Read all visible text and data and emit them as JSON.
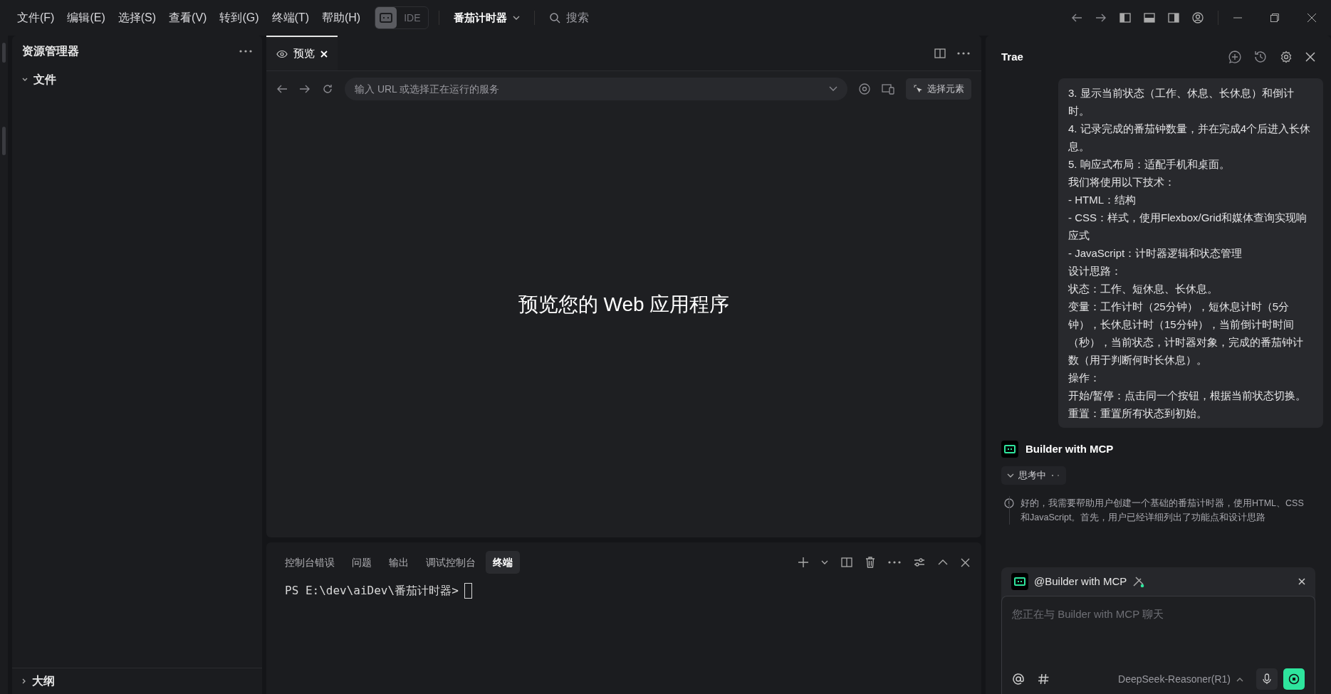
{
  "menu": [
    "文件(F)",
    "编辑(E)",
    "选择(S)",
    "查看(V)",
    "转到(G)",
    "终端(T)",
    "帮助(H)"
  ],
  "ide_toggle": {
    "label": "IDE",
    "on": false
  },
  "project": "番茄计时器",
  "search": {
    "placeholder": "搜索"
  },
  "explorer": {
    "title": "资源管理器",
    "sections": [
      {
        "label": "文件",
        "expanded": true
      },
      {
        "label": "大纲",
        "expanded": false
      }
    ]
  },
  "preview": {
    "tabs": [
      {
        "label": "预览",
        "selected": true
      }
    ],
    "url": {
      "placeholder": "输入 URL 或选择正在运行的服务"
    },
    "select_button": "选择元素",
    "message": "预览您的 Web 应用程序"
  },
  "panel": {
    "tabs": [
      {
        "label": "控制台错误",
        "selected": false
      },
      {
        "label": "问题",
        "selected": false
      },
      {
        "label": "输出",
        "selected": false
      },
      {
        "label": "调试控制台",
        "selected": false
      },
      {
        "label": "终端",
        "selected": true
      }
    ],
    "prompt": "PS E:\\dev\\aiDev\\番茄计时器>"
  },
  "assistant": {
    "title": "Trae",
    "message_lines": [
      "3. 显示当前状态（工作、休息、长休息）和倒计时。",
      "4. 记录完成的番茄钟数量，并在完成4个后进入长休息。",
      "5. 响应式布局：适配手机和桌面。",
      "我们将使用以下技术：",
      "- HTML：结构",
      "- CSS：样式，使用Flexbox/Grid和媒体查询实现响应式",
      "- JavaScript：计时器逻辑和状态管理",
      "设计思路：",
      "状态：工作、短休息、长休息。",
      "变量：工作计时（25分钟），短休息计时（5分钟），长休息计时（15分钟），当前倒计时时间（秒），当前状态，计时器对象，完成的番茄钟计数（用于判断何时长休息）。",
      "操作：",
      "开始/暂停：点击同一个按钮，根据当前状态切换。",
      "重置：重置所有状态到初始。"
    ],
    "agent": "Builder with MCP",
    "thinking": "思考中",
    "note": "好的，我需要帮助用户创建一个基础的番茄计时器，使用HTML、CSS和JavaScript。首先，用户已经详细列出了功能点和设计思路",
    "composer": {
      "agent": "@Builder with MCP",
      "placeholder": "您正在与 Builder with MCP 聊天",
      "model": "DeepSeek-Reasoner(R1)"
    }
  }
}
